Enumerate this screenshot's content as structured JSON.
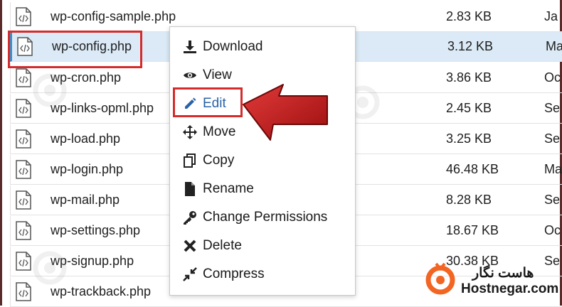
{
  "files": [
    {
      "name": "wp-config-sample.php",
      "size": "2.83 KB",
      "date": "Ja"
    },
    {
      "name": "wp-config.php",
      "size": "3.12 KB",
      "date": "Ma",
      "selected": true
    },
    {
      "name": "wp-cron.php",
      "size": "3.86 KB",
      "date": "Oc"
    },
    {
      "name": "wp-links-opml.php",
      "size": "2.45 KB",
      "date": "Se"
    },
    {
      "name": "wp-load.php",
      "size": "3.25 KB",
      "date": "Se"
    },
    {
      "name": "wp-login.php",
      "size": "46.48 KB",
      "date": "Ma"
    },
    {
      "name": "wp-mail.php",
      "size": "8.28 KB",
      "date": "Se"
    },
    {
      "name": "wp-settings.php",
      "size": "18.67 KB",
      "date": "Oc"
    },
    {
      "name": "wp-signup.php",
      "size": "30.38 KB",
      "date": "Se"
    },
    {
      "name": "wp-trackback.php",
      "size": "",
      "date": ""
    }
  ],
  "context_menu": {
    "items": [
      {
        "label": "Download",
        "icon": "download-icon"
      },
      {
        "label": "View",
        "icon": "eye-icon"
      },
      {
        "label": "Edit",
        "icon": "pencil-icon"
      },
      {
        "label": "Move",
        "icon": "move-icon"
      },
      {
        "label": "Copy",
        "icon": "copy-icon"
      },
      {
        "label": "Rename",
        "icon": "file-icon"
      },
      {
        "label": "Change Permissions",
        "icon": "key-icon"
      },
      {
        "label": "Delete",
        "icon": "x-icon"
      },
      {
        "label": "Compress",
        "icon": "compress-icon"
      }
    ]
  },
  "branding": {
    "name_fa": "هاست نگار",
    "name_en": "Hostnegar.com",
    "accent": "#f26522"
  },
  "colors": {
    "highlight": "#d52b2b",
    "selected_row": "#dbeaf6",
    "arrow": "#b81414"
  }
}
